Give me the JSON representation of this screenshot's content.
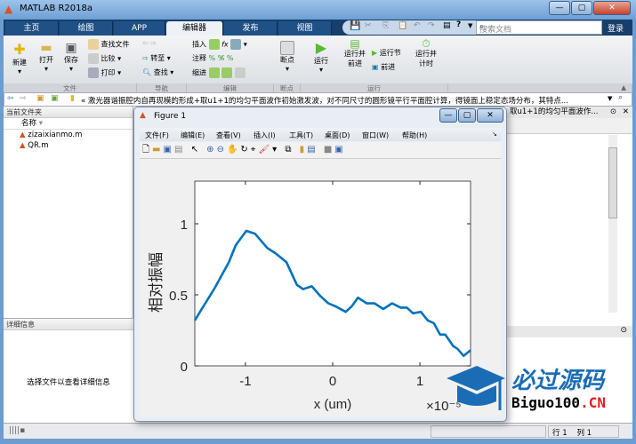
{
  "window": {
    "title": "MATLAB R2018a",
    "min": "—",
    "max": "▢",
    "close": "✕"
  },
  "tabs": [
    "主页",
    "绘图",
    "APP",
    "编辑器",
    "发布",
    "视图"
  ],
  "active_tab": "编辑器",
  "search": {
    "placeholder": "搜索文档"
  },
  "login": "登录",
  "ribbon": {
    "file": {
      "new": "新建",
      "open": "打开",
      "save": "保存",
      "find_files": "查找文件",
      "compare": "比较",
      "print": "打印",
      "label": "文件"
    },
    "nav": {
      "goto": "转至",
      "find": "查找",
      "label": "导航"
    },
    "edit": {
      "insert": "插入",
      "comment": "注释",
      "indent": "缩进",
      "fx": "fx",
      "label": "编辑"
    },
    "breakpoints": {
      "breakpoints": "断点",
      "label": "断点"
    },
    "run": {
      "run": "运行",
      "run_advance": "运行并\n前进",
      "run_section": "运行节",
      "advance": "前进",
      "run_time": "运行并\n计时",
      "label": "运行"
    }
  },
  "address": "« 激光器谐振腔内自再现模的形成+取u1+1的均匀平面波作初始激发波，对不同尺寸的圆形镜平行平面腔计算，得镜面上稳定态场分布，其特点...",
  "current_folder": {
    "title": "当前文件夹",
    "column": "名称",
    "files": [
      "zizaixianmo.m",
      "QR.m"
    ]
  },
  "details": {
    "title": "详细信息",
    "message": "选择文件以查看详细信息"
  },
  "editor_tab": "取u1+1的均匀平面波作...",
  "status": {
    "row_label": "行",
    "row": "1",
    "col_label": "列",
    "col": "1"
  },
  "figure": {
    "title": "Figure 1",
    "menu": [
      "文件(F)",
      "编辑(E)",
      "查看(V)",
      "插入(I)",
      "工具(T)",
      "桌面(D)",
      "窗口(W)",
      "帮助(H)"
    ]
  },
  "watermark": {
    "cn": "必过源码",
    "en": "Biguo100",
    ".cn": ".CN"
  },
  "chart_data": {
    "type": "line",
    "xlabel": "x (um)",
    "ylabel": "相对振幅",
    "x_exponent": "×10⁻⁵",
    "xlim": [
      -1.58,
      1.58
    ],
    "ylim": [
      0,
      1.3
    ],
    "xticks": [
      -1,
      0,
      1
    ],
    "xtick_labels": [
      "-1",
      "0",
      "1"
    ],
    "yticks": [
      0,
      0.5,
      1
    ],
    "ytick_labels": [
      "0",
      "0.5",
      "1"
    ],
    "color": "#0072bd",
    "x": [
      -1.58,
      -1.5,
      -1.35,
      -1.19,
      -1.11,
      -0.99,
      -0.89,
      -0.75,
      -0.65,
      -0.53,
      -0.41,
      -0.34,
      -0.24,
      -0.14,
      -0.05,
      0.03,
      0.15,
      0.22,
      0.29,
      0.39,
      0.48,
      0.58,
      0.68,
      0.78,
      0.85,
      0.92,
      1.01,
      1.09,
      1.16,
      1.23,
      1.29,
      1.38,
      1.43,
      1.5,
      1.58
    ],
    "y": [
      0.32,
      0.4,
      0.55,
      0.73,
      0.85,
      0.95,
      0.93,
      0.83,
      0.79,
      0.73,
      0.57,
      0.54,
      0.56,
      0.49,
      0.44,
      0.42,
      0.38,
      0.42,
      0.48,
      0.44,
      0.44,
      0.4,
      0.44,
      0.41,
      0.41,
      0.37,
      0.38,
      0.32,
      0.3,
      0.22,
      0.22,
      0.14,
      0.12,
      0.07,
      0.11
    ]
  }
}
